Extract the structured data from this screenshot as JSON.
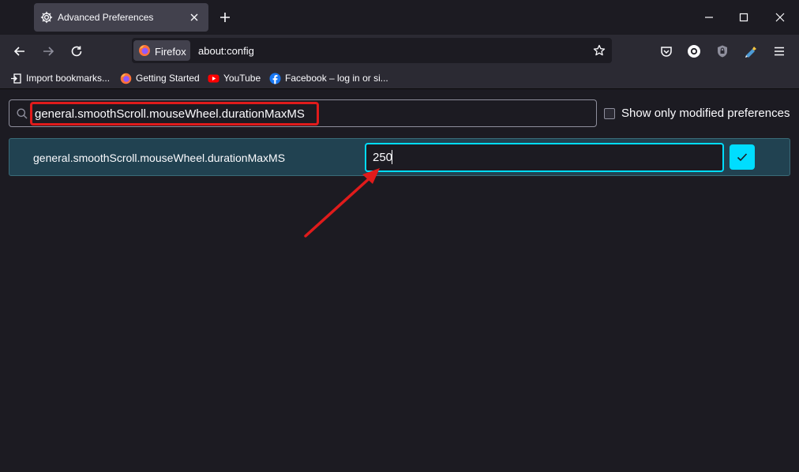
{
  "tab": {
    "title": "Advanced Preferences"
  },
  "urlbar": {
    "identity_label": "Firefox",
    "url": "about:config"
  },
  "bookmarks": [
    {
      "label": "Import bookmarks...",
      "icon": "import-icon"
    },
    {
      "label": "Getting Started",
      "icon": "firefox-icon"
    },
    {
      "label": "YouTube",
      "icon": "youtube-icon"
    },
    {
      "label": "Facebook – log in or si...",
      "icon": "facebook-icon"
    }
  ],
  "search": {
    "value": "general.smoothScroll.mouseWheel.durationMaxMS"
  },
  "modified_toggle": {
    "label": "Show only modified preferences",
    "checked": false
  },
  "pref": {
    "name": "general.smoothScroll.mouseWheel.durationMaxMS",
    "value": "250"
  },
  "colors": {
    "accent": "#00ddff",
    "annotation": "#e01b1b",
    "row_bg": "#214251"
  }
}
